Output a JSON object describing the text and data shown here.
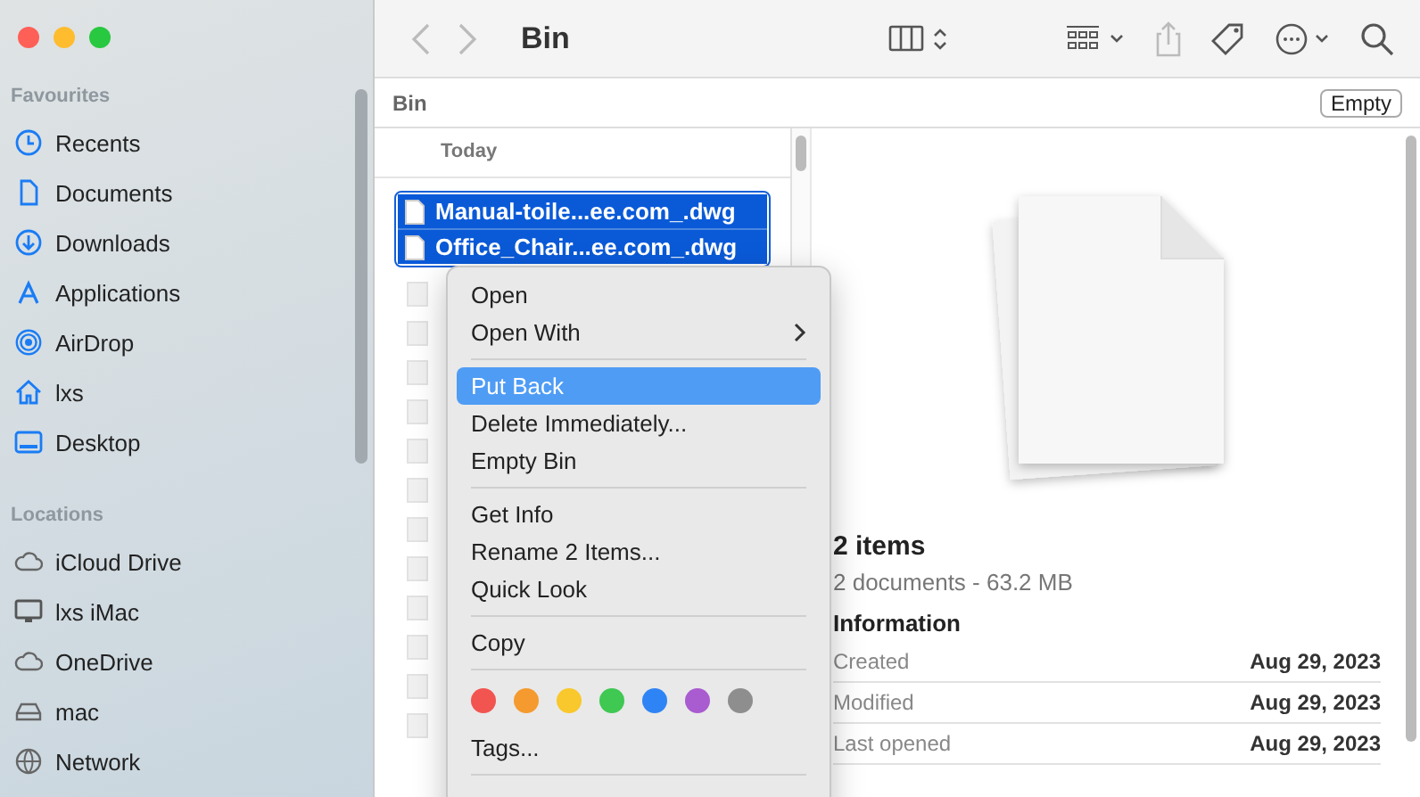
{
  "window": {
    "title": "Bin"
  },
  "sidebar": {
    "sections": [
      {
        "heading": "Favourites",
        "items": [
          {
            "label": "Recents"
          },
          {
            "label": "Documents"
          },
          {
            "label": "Downloads"
          },
          {
            "label": "Applications"
          },
          {
            "label": "AirDrop"
          },
          {
            "label": "lxs"
          },
          {
            "label": "Desktop"
          }
        ]
      },
      {
        "heading": "Locations",
        "items": [
          {
            "label": "iCloud Drive"
          },
          {
            "label": "lxs iMac"
          },
          {
            "label": "OneDrive"
          },
          {
            "label": "mac"
          },
          {
            "label": "Network"
          }
        ]
      }
    ]
  },
  "path_bar": {
    "location": "Bin",
    "empty_button": "Empty"
  },
  "file_list": {
    "group": "Today",
    "rows": [
      {
        "name": "Manual-toile...ee.com_.dwg",
        "selected": true
      },
      {
        "name": "Office_Chair...ee.com_.dwg",
        "selected": true
      }
    ]
  },
  "context_menu": {
    "groups": [
      [
        {
          "label": "Open",
          "submenu": false,
          "selected": false
        },
        {
          "label": "Open With",
          "submenu": true,
          "selected": false
        }
      ],
      [
        {
          "label": "Put Back",
          "submenu": false,
          "selected": true
        },
        {
          "label": "Delete Immediately...",
          "submenu": false,
          "selected": false
        },
        {
          "label": "Empty Bin",
          "submenu": false,
          "selected": false
        }
      ],
      [
        {
          "label": "Get Info",
          "submenu": false,
          "selected": false
        },
        {
          "label": "Rename 2 Items...",
          "submenu": false,
          "selected": false
        },
        {
          "label": "Quick Look",
          "submenu": false,
          "selected": false
        }
      ],
      [
        {
          "label": "Copy",
          "submenu": false,
          "selected": false
        }
      ]
    ],
    "tags": [
      {
        "color": "#f25450"
      },
      {
        "color": "#f59a2f"
      },
      {
        "color": "#f8c82c"
      },
      {
        "color": "#3fc852"
      },
      {
        "color": "#2f84f5"
      },
      {
        "color": "#a95bd0"
      },
      {
        "color": "#8e8e8e"
      }
    ],
    "tags_item": "Tags..."
  },
  "preview": {
    "title": "2 items",
    "subtitle": "2 documents - 63.2 MB",
    "info_heading": "Information",
    "info": [
      {
        "label": "Created",
        "value": "Aug 29, 2023"
      },
      {
        "label": "Modified",
        "value": "Aug 29, 2023"
      },
      {
        "label": "Last opened",
        "value": "Aug 29, 2023"
      }
    ]
  }
}
